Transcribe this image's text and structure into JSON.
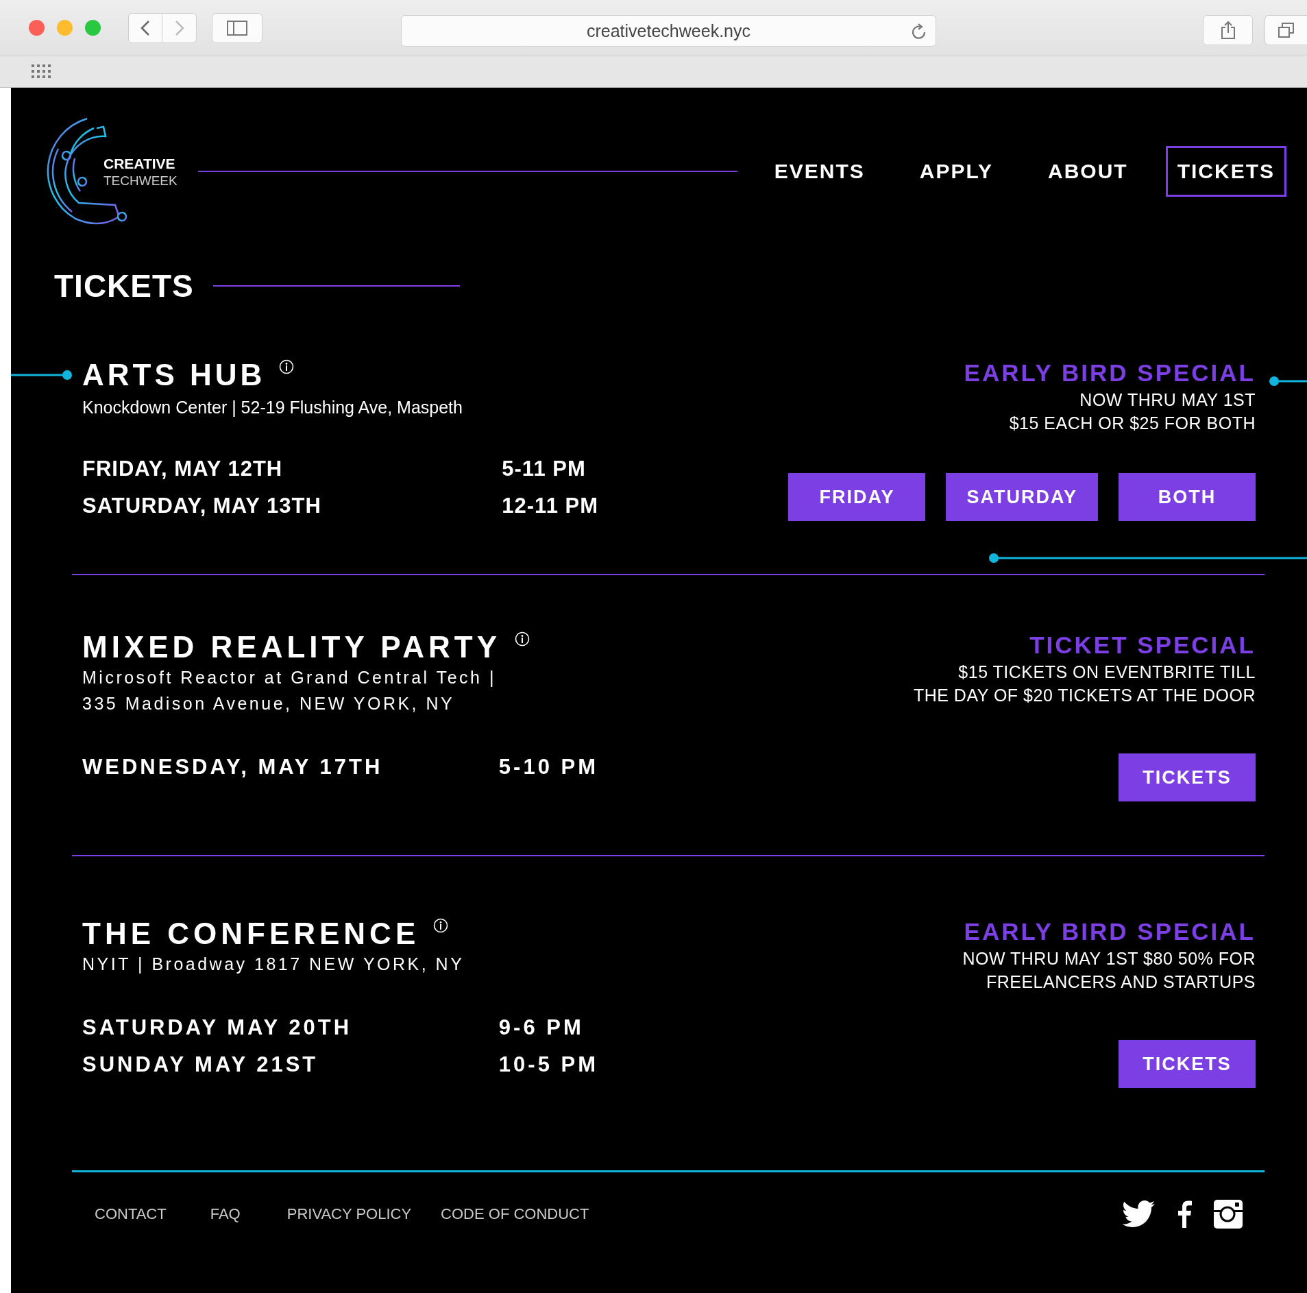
{
  "browser": {
    "url": "creativetechweek.nyc"
  },
  "logo": {
    "line1": "CREATIVE",
    "line2": "TECHWEEK"
  },
  "nav": [
    {
      "label": "EVENTS",
      "selected": false
    },
    {
      "label": "APPLY",
      "selected": false
    },
    {
      "label": "ABOUT",
      "selected": false
    },
    {
      "label": "TICKETS",
      "selected": true
    }
  ],
  "page_title": "TICKETS",
  "events": [
    {
      "kind": "compact",
      "title": "ARTS HUB",
      "venue": [
        "Knockdown Center | 52-19 Flushing Ave, Maspeth"
      ],
      "schedule": [
        {
          "day": "FRIDAY, MAY 12TH",
          "time": "5-11 PM"
        },
        {
          "day": "SATURDAY, MAY 13TH",
          "time": "12-11 PM"
        }
      ],
      "offer": {
        "title": "EARLY BIRD SPECIAL",
        "lines": [
          "NOW THRU MAY 1ST",
          "$15 EACH OR $25 FOR BOTH"
        ]
      },
      "buttons": [
        "FRIDAY",
        "SATURDAY",
        "BOTH"
      ]
    },
    {
      "kind": "spaced",
      "title": "MIXED REALITY PARTY",
      "venue": [
        "Microsoft Reactor at Grand Central Tech |",
        "335 Madison Avenue, NEW YORK, NY"
      ],
      "schedule": [
        {
          "day": "WEDNESDAY, MAY 17TH",
          "time": "5-10 PM"
        }
      ],
      "offer": {
        "title": "TICKET SPECIAL",
        "lines": [
          "$15 TICKETS  ON EVENTBRITE  TILL",
          "THE DAY OF $20 TICKETS AT THE DOOR"
        ]
      },
      "buttons": [
        "TICKETS"
      ]
    },
    {
      "kind": "spaced",
      "title": "THE CONFERENCE",
      "venue": [
        "NYIT |  Broadway 1817 NEW YORK, NY"
      ],
      "schedule": [
        {
          "day": "SATURDAY MAY 20TH",
          "time": "9-6 PM"
        },
        {
          "day": "SUNDAY MAY 21ST",
          "time": "10-5 PM"
        }
      ],
      "offer": {
        "title": "EARLY BIRD SPECIAL",
        "lines": [
          "NOW THRU MAY 1ST $80 50% FOR",
          "FREELANCERS AND STARTUPS"
        ]
      },
      "buttons": [
        "TICKETS"
      ]
    }
  ],
  "footer": {
    "links": [
      "CONTACT",
      "FAQ",
      "PRIVACY POLICY",
      "CODE OF CONDUCT"
    ]
  }
}
